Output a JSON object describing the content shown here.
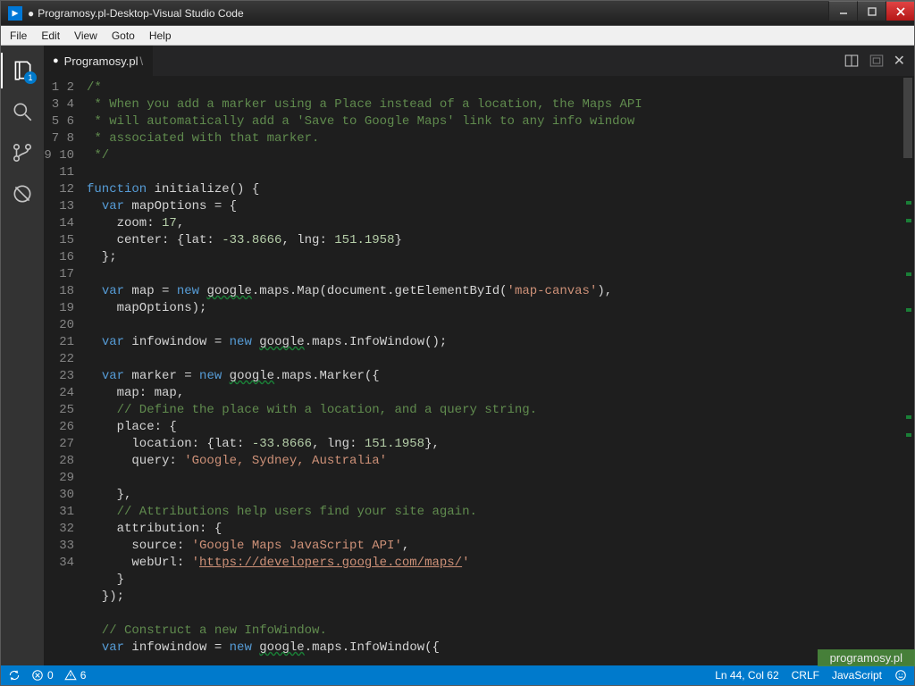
{
  "window": {
    "title_tab": "Programosy.pl",
    "title_folder": "Desktop",
    "title_app": "Visual Studio Code",
    "title_sep": " - ",
    "dirty_mark": "●"
  },
  "menu": {
    "items": [
      "File",
      "Edit",
      "View",
      "Goto",
      "Help"
    ]
  },
  "activity": {
    "explorer_badge": "1"
  },
  "tab": {
    "name": "Programosy.pl",
    "dirty": "●",
    "trail": "\\"
  },
  "code": {
    "lines_count": 34,
    "l1": "/*",
    "l2": " * When you add a marker using a Place instead of a location, the Maps API",
    "l3": " * will automatically add a 'Save to Google Maps' link to any info window",
    "l4": " * associated with that marker.",
    "l5": " */",
    "l6": "",
    "l7_kw": "function",
    "l7a": " ",
    "l7_fn": "initialize",
    "l7b": "() {",
    "l8_ind": "  ",
    "l8_kw": "var",
    "l8a": " mapOptions = {",
    "l9": "    zoom: ",
    "l9_num": "17",
    "l9b": ",",
    "l10": "    center: {lat: ",
    "l10_num1": "-33.8666",
    "l10a": ", lng: ",
    "l10_num2": "151.1958",
    "l10b": "}",
    "l11": "  };",
    "l12": "",
    "l13_ind": "  ",
    "l13_kw": "var",
    "l13a": " map = ",
    "l13_kw2": "new",
    "l13b": " ",
    "l13_wave": "google",
    "l13c": ".maps.Map(document.getElementById(",
    "l13_str": "'map-canvas'",
    "l13d": "),",
    "l14": "    mapOptions);",
    "l15": "",
    "l16_ind": "  ",
    "l16_kw": "var",
    "l16a": " infowindow = ",
    "l16_kw2": "new",
    "l16b": " ",
    "l16_wave": "google",
    "l16c": ".maps.InfoWindow();",
    "l17": "",
    "l18_ind": "  ",
    "l18_kw": "var",
    "l18a": " marker = ",
    "l18_kw2": "new",
    "l18b": " ",
    "l18_wave": "google",
    "l18c": ".maps.Marker({",
    "l19": "    map: map,",
    "l20": "    // Define the place with a location, and a query string.",
    "l21": "    place: {",
    "l22": "      location: {lat: ",
    "l22_num1": "-33.8666",
    "l22a": ", lng: ",
    "l22_num2": "151.1958",
    "l22b": "},",
    "l23": "      query: ",
    "l23_str": "'Google, Sydney, Australia'",
    "l24": "",
    "l25": "    },",
    "l26": "    // Attributions help users find your site again.",
    "l27": "    attribution: {",
    "l28": "      source: ",
    "l28_str": "'Google Maps JavaScript API'",
    "l28b": ",",
    "l29": "      webUrl: ",
    "l29_q": "'",
    "l29_link": "https://developers.google.com/maps/",
    "l29_q2": "'",
    "l30": "    }",
    "l31": "  });",
    "l32": "",
    "l33": "  // Construct a new InfoWindow.",
    "l34_ind": "  ",
    "l34_kw": "var",
    "l34a": " infowindow = ",
    "l34_kw2": "new",
    "l34b": " ",
    "l34_wave": "google",
    "l34c": ".maps.InfoWindow({"
  },
  "status": {
    "errors": "0",
    "warnings": "6",
    "ln_col": "Ln 44, Col 62",
    "eol": "CRLF",
    "lang": "JavaScript",
    "sync_left_pad": "",
    "watermark": "programosy.pl"
  }
}
